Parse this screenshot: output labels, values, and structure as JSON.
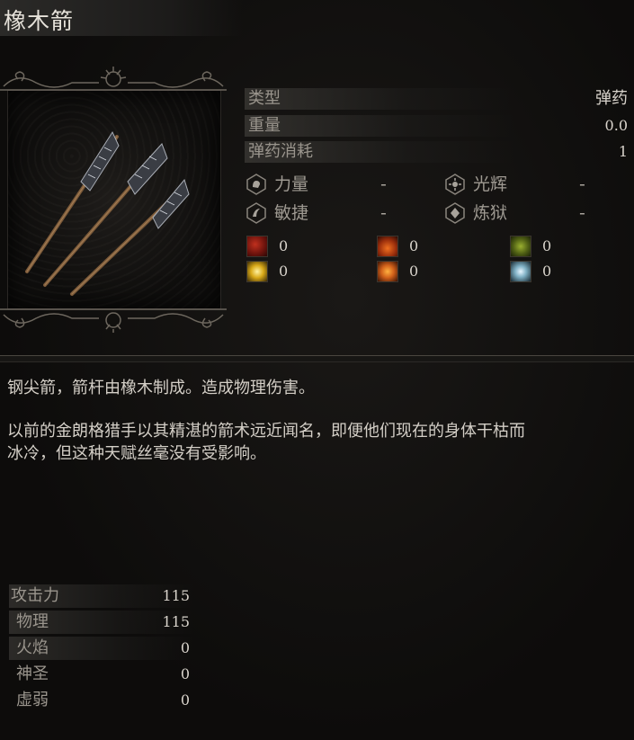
{
  "item": {
    "name": "橡木箭"
  },
  "stats": [
    {
      "label": "类型",
      "value": "弹药"
    },
    {
      "label": "重量",
      "value": "0.0"
    },
    {
      "label": "弹药消耗",
      "value": "1"
    }
  ],
  "attributes": [
    {
      "label": "力量",
      "value": "-",
      "icon": "strength-icon"
    },
    {
      "label": "光辉",
      "value": "-",
      "icon": "radiance-icon"
    },
    {
      "label": "敏捷",
      "value": "-",
      "icon": "dexterity-icon"
    },
    {
      "label": "炼狱",
      "value": "-",
      "icon": "inferno-icon"
    }
  ],
  "resistances": [
    {
      "value": "0",
      "icon": "bleed-icon",
      "color": "#8a1a12"
    },
    {
      "value": "0",
      "icon": "fire-buildup-icon",
      "color": "#b4400f"
    },
    {
      "value": "0",
      "icon": "poison-icon",
      "color": "#6a7a1c"
    },
    {
      "value": "0",
      "icon": "holy-icon",
      "color": "#d8a818"
    },
    {
      "value": "0",
      "icon": "burn-icon",
      "color": "#d0601a"
    },
    {
      "value": "0",
      "icon": "frost-icon",
      "color": "#7fb0c4"
    }
  ],
  "description": {
    "p1": "钢尖箭，箭杆由橡木制成。造成物理伤害。",
    "p2_line1": "以前的金朗格猎手以其精湛的箭术远近闻名，即便他们现在的身体干枯而",
    "p2_line2": "冰冷，但这种天赋丝毫没有受影响。"
  },
  "attack": [
    {
      "label": "攻击力",
      "value": "115"
    },
    {
      "label": "物理",
      "value": "115"
    },
    {
      "label": "火焰",
      "value": "0"
    },
    {
      "label": "神圣",
      "value": "0"
    },
    {
      "label": "虚弱",
      "value": "0"
    }
  ]
}
